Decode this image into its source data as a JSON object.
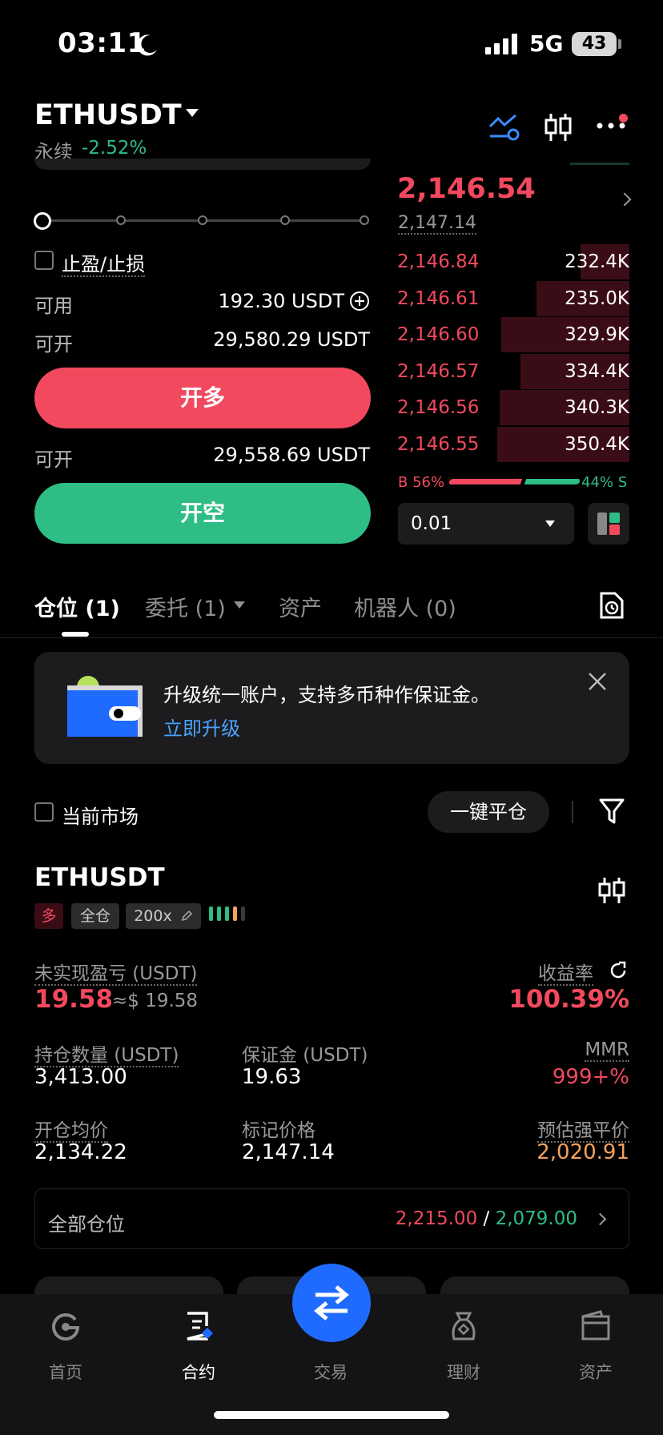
{
  "status_bar": {
    "time": "03:11",
    "network": "5G",
    "battery": "43"
  },
  "header": {
    "symbol": "ETHUSDT",
    "type_label": "永续",
    "change": "-2.52%"
  },
  "order_form": {
    "leverage_fraction": 0.0,
    "tpsl_label": "止盈/止损",
    "available_label": "可用",
    "available_value": "192.30 USDT",
    "can_open_label": "可开",
    "can_open_long_value": "29,580.29 USDT",
    "long_button": "开多",
    "can_open_short_value": "29,558.69 USDT",
    "short_button": "开空"
  },
  "order_book": {
    "last_price": "2,146.54",
    "mark_price": "2,147.14",
    "asks": [
      {
        "price": "2,146.84",
        "amount": "232.4K",
        "depth": 0.21
      },
      {
        "price": "2,146.61",
        "amount": "235.0K",
        "depth": 0.4
      },
      {
        "price": "2,146.60",
        "amount": "329.9K",
        "depth": 0.55
      },
      {
        "price": "2,146.57",
        "amount": "334.4K",
        "depth": 0.47
      },
      {
        "price": "2,146.56",
        "amount": "340.3K",
        "depth": 0.56
      },
      {
        "price": "2,146.55",
        "amount": "350.4K",
        "depth": 0.57
      }
    ],
    "buy_ratio": "B 56%",
    "sell_ratio": "44% S",
    "precision": "0.01"
  },
  "tabs": [
    {
      "label": "仓位 (1)"
    },
    {
      "label": "委托 (1)"
    },
    {
      "label": "资产"
    },
    {
      "label": "机器人 (0)"
    }
  ],
  "banner": {
    "text": "升级统一账户，支持多币种作保证金。",
    "link": "立即升级"
  },
  "filters": {
    "current_market": "当前市场",
    "close_all": "一键平仓"
  },
  "position": {
    "symbol": "ETHUSDT",
    "side": "多",
    "margin_mode": "全仓",
    "leverage": "200x",
    "pnl_label": "未实现盈亏 (USDT)",
    "pnl_value": "19.58",
    "pnl_usd": "≈$ 19.58",
    "roe_label": "收益率",
    "roe_value": "100.39%",
    "qty_label": "持仓数量 (USDT)",
    "qty_value": "3,413.00",
    "margin_label": "保证金 (USDT)",
    "margin_value": "19.63",
    "mmr_label": "MMR",
    "mmr_value": "999+%",
    "entry_label": "开仓均价",
    "entry_value": "2,134.22",
    "mark_label": "标记价格",
    "mark_value": "2,147.14",
    "liq_label": "预估强平价",
    "liq_value": "2,020.91"
  },
  "all_positions": {
    "label": "全部仓位",
    "high": "2,215.00",
    "separator": " / ",
    "low": "2,079.00"
  },
  "bottom_nav": [
    {
      "label": "首页",
      "icon": "home-icon"
    },
    {
      "label": "合约",
      "icon": "contract-icon"
    },
    {
      "label": "交易",
      "icon": "trade-swap-icon"
    },
    {
      "label": "理财",
      "icon": "finance-icon"
    },
    {
      "label": "资产",
      "icon": "wallet-icon"
    }
  ],
  "colors": {
    "red": "#f2495e",
    "green": "#2ebd85",
    "accent_blue": "#1f6bff",
    "link_blue": "#4aa3ff",
    "liq_orange": "#f5a25d"
  }
}
